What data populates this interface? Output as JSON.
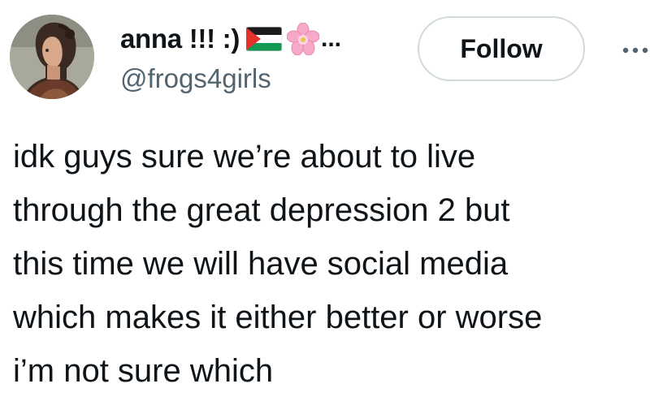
{
  "user": {
    "display_name": "anna !!! :)",
    "name_truncation": "...",
    "handle": "@frogs4girls",
    "avatar_icon": "avatar-portrait",
    "name_emojis": [
      "palestine-flag-emoji",
      "cherry-blossom-emoji"
    ]
  },
  "actions": {
    "follow_label": "Follow",
    "more_icon": "more-options-icon"
  },
  "tweet": {
    "lines": [
      "idk guys sure we’re about to live",
      "through the great depression 2 but",
      "this time we will have social media",
      "which makes it either better or worse",
      "i’m not sure which"
    ]
  },
  "colors": {
    "text_primary": "#0f1419",
    "text_secondary": "#536471",
    "button_border": "#cfd9de",
    "background": "#ffffff"
  }
}
